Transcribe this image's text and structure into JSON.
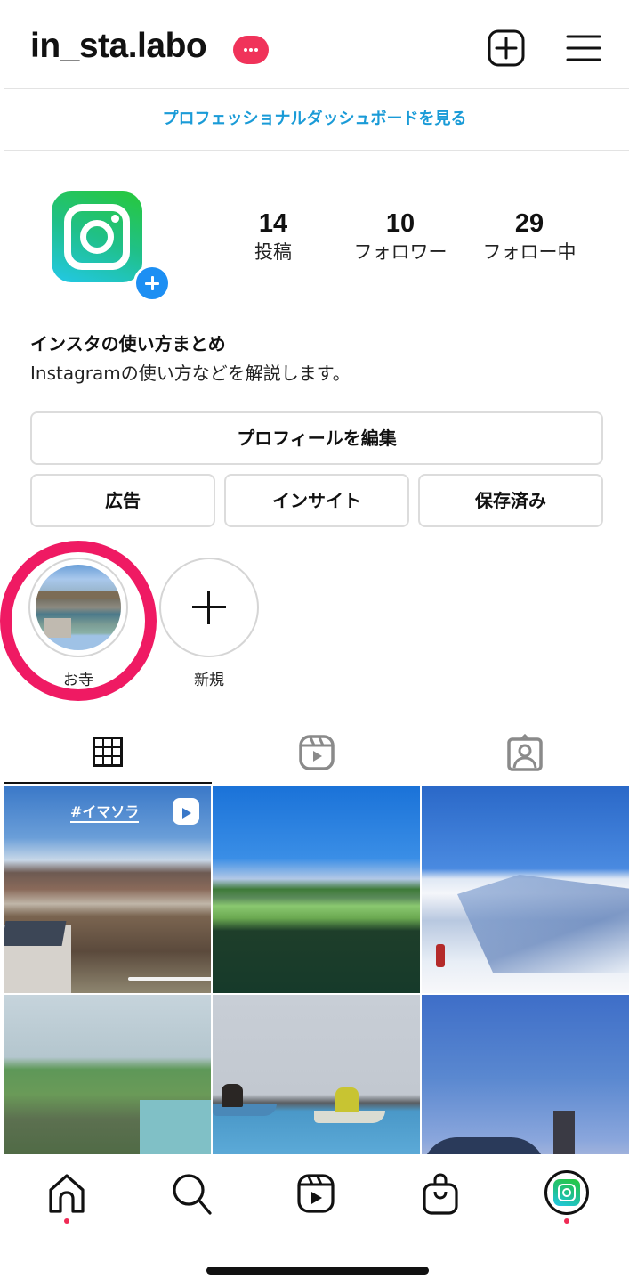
{
  "header": {
    "username": "in_sta.labo",
    "notification_badge": "more-dots-badge",
    "add_icon": "plus-square-icon",
    "menu_icon": "hamburger-menu-icon"
  },
  "dashboard_link": "プロフェッショナルダッシュボードを見る",
  "profile": {
    "avatar_icon": "instagram-logo-icon",
    "stats": [
      {
        "value": "14",
        "label": "投稿"
      },
      {
        "value": "10",
        "label": "フォロワー"
      },
      {
        "value": "29",
        "label": "フォロー中"
      }
    ],
    "bio_name": "インスタの使い方まとめ",
    "bio_text": "Instagramの使い方などを解説します。"
  },
  "buttons": {
    "edit_profile": "プロフィールを編集",
    "ads": "広告",
    "insights": "インサイト",
    "saved": "保存済み"
  },
  "highlights": [
    {
      "label": "お寺"
    },
    {
      "label": "新規"
    }
  ],
  "tabs": [
    {
      "name": "grid",
      "icon": "grid-icon",
      "active": true
    },
    {
      "name": "reels",
      "icon": "reels-icon",
      "active": false
    },
    {
      "name": "tagged",
      "icon": "tagged-person-icon",
      "active": false
    }
  ],
  "posts": [
    {
      "description": "mountain town view",
      "overlay_text": "#イマソラ",
      "is_reel": true
    },
    {
      "description": "lake and meadow"
    },
    {
      "description": "snowy mountain ridge with hiker"
    },
    {
      "description": "coastal cliffs"
    },
    {
      "description": "kayakers on sea"
    },
    {
      "description": "mountain summit towers at dusk"
    }
  ],
  "bottom_nav": [
    {
      "name": "home",
      "icon": "home-icon",
      "has_dot": true
    },
    {
      "name": "search",
      "icon": "search-icon",
      "has_dot": false
    },
    {
      "name": "reels",
      "icon": "reels-icon",
      "has_dot": false
    },
    {
      "name": "shop",
      "icon": "shopping-bag-icon",
      "has_dot": false
    },
    {
      "name": "profile",
      "icon": "profile-avatar-icon",
      "has_dot": true
    }
  ],
  "colors": {
    "link_blue": "#1a9bd7",
    "badge_red": "#f0335a",
    "annotation_pink": "#ef1a63",
    "add_blue": "#1d8ff3"
  }
}
